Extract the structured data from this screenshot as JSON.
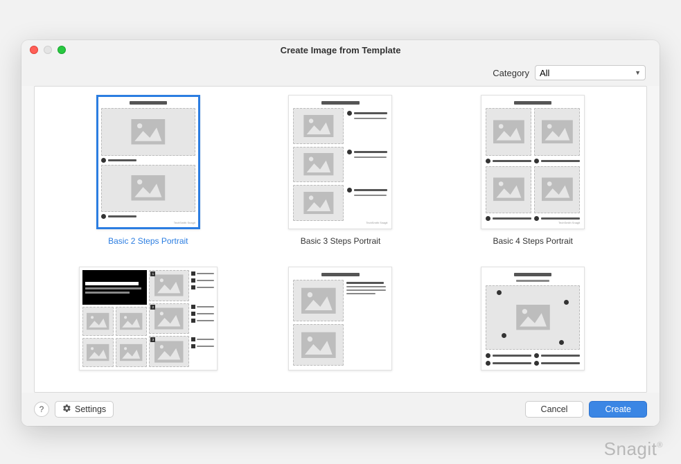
{
  "window": {
    "title": "Create Image from Template"
  },
  "toolbar": {
    "category_label": "Category",
    "category_value": "All"
  },
  "templates": [
    {
      "label": "Basic 2 Steps Portrait",
      "selected": true
    },
    {
      "label": "Basic 3 Steps Portrait",
      "selected": false
    },
    {
      "label": "Basic 4 Steps Portrait",
      "selected": false
    },
    {
      "label": "",
      "selected": false
    },
    {
      "label": "",
      "selected": false
    },
    {
      "label": "",
      "selected": false
    }
  ],
  "footer": {
    "settings_label": "Settings",
    "cancel_label": "Cancel",
    "create_label": "Create",
    "help_label": "?"
  },
  "brand": "Snagit"
}
